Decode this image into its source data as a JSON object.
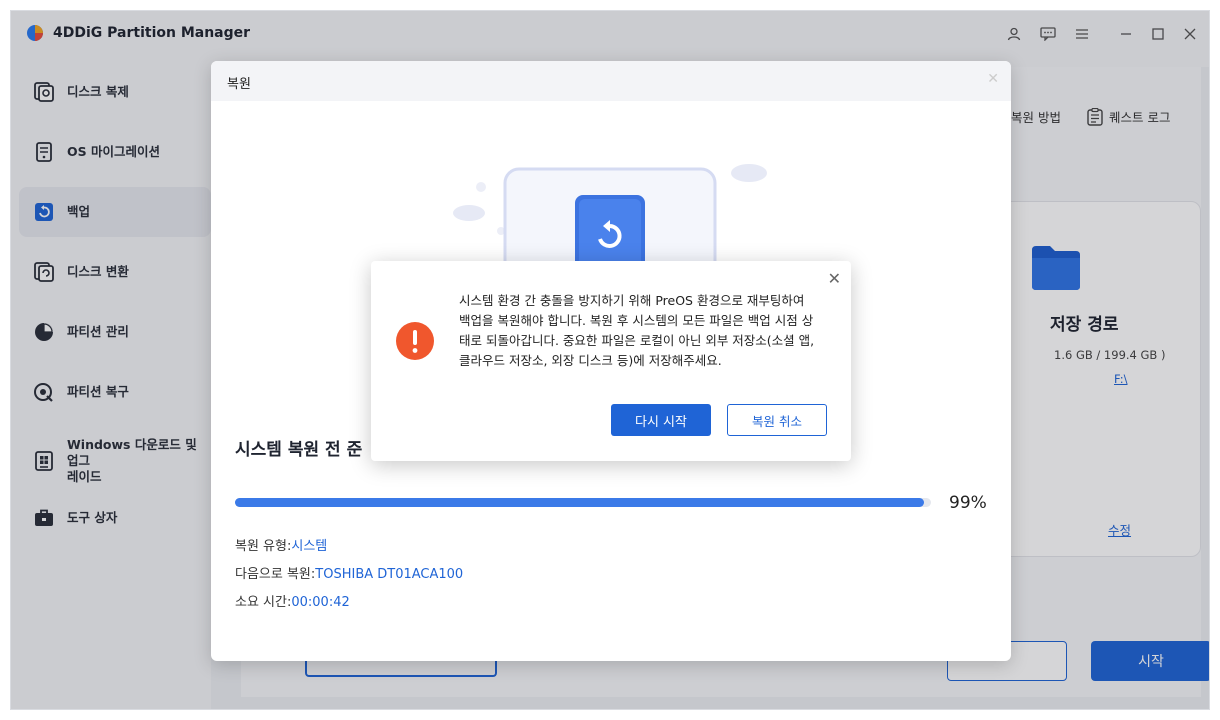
{
  "app": {
    "title": "4DDiG Partition Manager"
  },
  "window_controls": [
    "user-icon",
    "feedback-icon",
    "menu-icon",
    "minimize-icon",
    "maximize-icon",
    "close-icon"
  ],
  "sidebar": {
    "items": [
      {
        "label": "디스크 복제",
        "icon": "disk-clone-icon"
      },
      {
        "label": "OS 마이그레이션",
        "icon": "os-migration-icon"
      },
      {
        "label": "백업",
        "icon": "backup-icon",
        "active": true
      },
      {
        "label": "디스크 변환",
        "icon": "disk-convert-icon"
      },
      {
        "label": "파티션 관리",
        "icon": "partition-manage-icon"
      },
      {
        "label": "파티션 복구",
        "icon": "partition-recover-icon"
      },
      {
        "label": "Windows 다운로드 및 업그\n레이드",
        "icon": "windows-download-icon"
      },
      {
        "label": "도구 상자",
        "icon": "toolbox-icon"
      }
    ]
  },
  "background": {
    "restore_method_link": "복원 방법",
    "quest_log_link": "퀘스트 로그",
    "destination_title": "저장 경로",
    "destination_size": "1.6 GB / 199.4 GB )",
    "destination_drive": "F:\\",
    "edit_link": "수정",
    "start_button": "시작"
  },
  "modal": {
    "title": "복원",
    "heading": "시스템 복원 전 준",
    "progress": 99,
    "progress_text": "99%",
    "restore_type_label": "복원 유형:",
    "restore_type_value": "시스템",
    "restore_target_label": "다음으로 복원:",
    "restore_target_value": "TOSHIBA DT01ACA100",
    "elapsed_label": "소요 시간:",
    "elapsed_value": "00:00:42"
  },
  "dialog": {
    "message": "시스템 환경 간 충돌을 방지하기 위해 PreOS 환경으로 재부팅하여 백업을 복원해야 합니다. 복원 후 시스템의 모든 파일은 백업 시점 상태로 되돌아갑니다. 중요한 파일은 로컬이 아닌 외부 저장소(소셜 앱, 클라우드 저장소, 외장 디스크 등)에 저장해주세요.",
    "restart_button": "다시 시작",
    "cancel_button": "복원 취소"
  },
  "colors": {
    "accent": "#1f64d6",
    "progress": "#3b7ae8",
    "warning": "#f0572d"
  }
}
